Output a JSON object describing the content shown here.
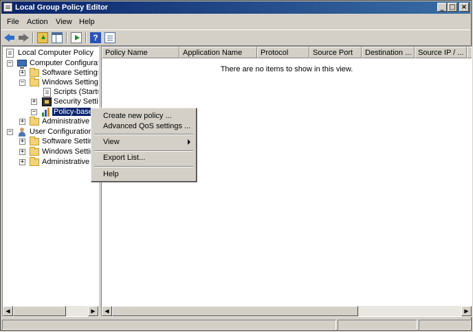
{
  "window": {
    "title": "Local Group Policy Editor"
  },
  "titlebar_buttons": {
    "minimize": "_",
    "maximize": "□",
    "close": "×"
  },
  "menubar": [
    "File",
    "Action",
    "View",
    "Help"
  ],
  "toolbar": {
    "icons": [
      "back-arrow-icon",
      "forward-arrow-icon",
      "up-folder-icon",
      "show-hide-tree-icon",
      "export-list-icon",
      "help-icon",
      "properties-icon"
    ],
    "help_glyph": "?"
  },
  "tree": {
    "root": "Local Computer Policy",
    "computer_configuration": "Computer Configuratio",
    "cc_software_settings": "Software Settings",
    "cc_windows_settings": "Windows Settings",
    "scripts": "Scripts (Startuj",
    "security_settings": "Security Settin",
    "policy_based_qos": "Policy-based",
    "cc_admin_templates": "Administrative Te",
    "user_configuration": "User Configuration",
    "uc_software_settings": "Software Setting",
    "uc_windows_settings": "Windows Setting",
    "uc_admin_templates": "Administrative Te",
    "expanded_glyph": "−",
    "collapsed_glyph": "+"
  },
  "list": {
    "columns": [
      "Policy Name",
      "Application Name",
      "Protocol",
      "Source Port",
      "Destination ...",
      "Source IP / ..."
    ],
    "empty_message": "There are no items to show in this view."
  },
  "scrollbar": {
    "left_glyph": "◀",
    "right_glyph": "▶"
  },
  "context_menu": {
    "create_new_policy": "Create new policy ...",
    "advanced_qos": "Advanced QoS settings ...",
    "view": "View",
    "export_list": "Export List...",
    "help": "Help"
  },
  "colors": {
    "selection": "#0a246a",
    "titlebar": "#0a246a",
    "face": "#d4d0c8"
  }
}
